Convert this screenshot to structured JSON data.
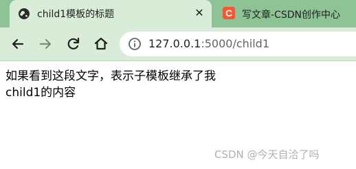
{
  "tabs": [
    {
      "title": "child1模板的标题",
      "icon": "globe-icon",
      "close": "✕",
      "active": true
    },
    {
      "title": "写文章-CSDN创作中心",
      "icon": "csdn-logo-icon",
      "favicon_text": "C",
      "active": false
    }
  ],
  "toolbar": {
    "back_icon": "arrow-left-icon",
    "forward_icon": "arrow-right-icon",
    "reload_icon": "reload-icon",
    "home_icon": "home-icon"
  },
  "address": {
    "host": "127.0.0.1",
    "rest": ":5000/child1",
    "info_icon": "info-icon"
  },
  "content": {
    "line1": "如果看到这段文字，表示子模板继承了我",
    "line2": "child1的内容"
  },
  "watermark": "CSDN @今天自洽了吗",
  "colors": {
    "tabstrip": "#8ec395",
    "toolbar": "#d8ecd8",
    "csdn_brand": "#fc5531"
  }
}
